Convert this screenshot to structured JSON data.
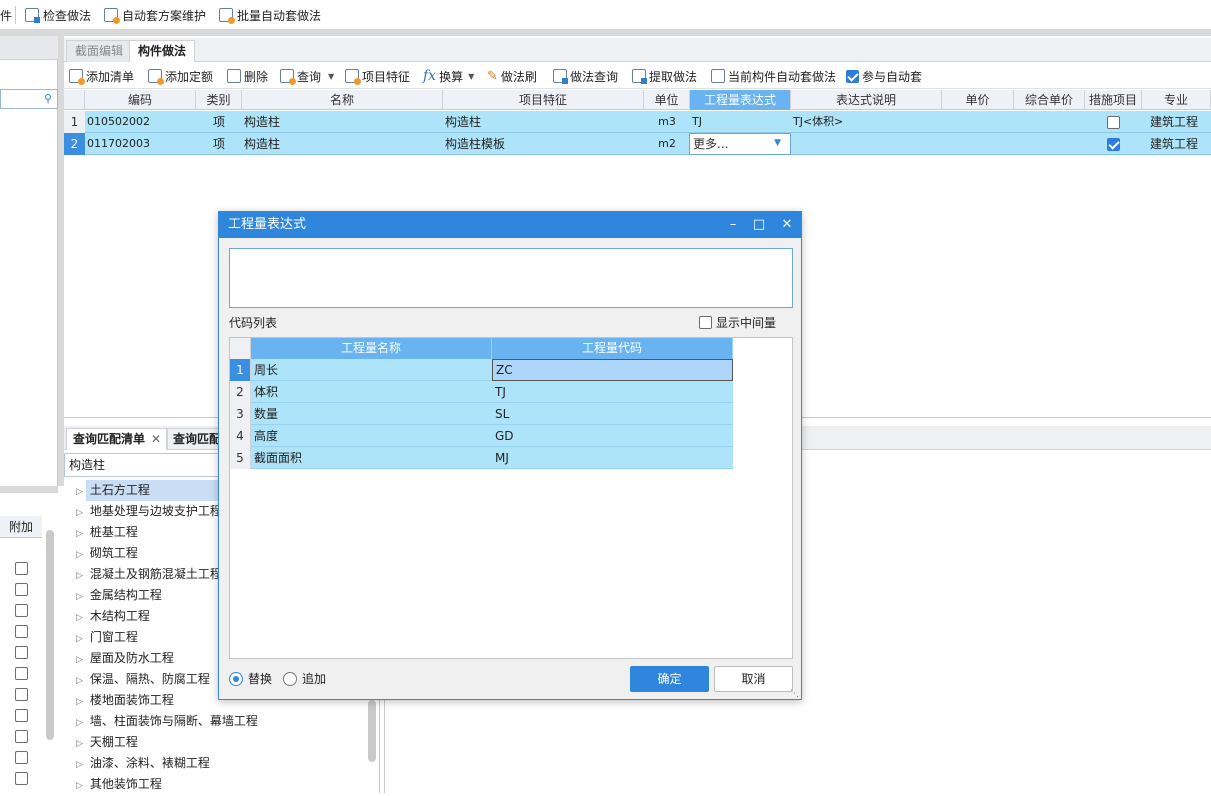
{
  "topbar": {
    "partial_label": "件",
    "items": [
      {
        "label": "检查做法",
        "icon": "check-doc-icon"
      },
      {
        "label": "自动套方案维护",
        "icon": "scheme-maintain-icon"
      },
      {
        "label": "批量自动套做法",
        "icon": "batch-apply-icon"
      }
    ]
  },
  "tabs": [
    "截面编辑",
    "构件做法"
  ],
  "toolbar": [
    {
      "label": "添加清单",
      "icon": "add-list-icon"
    },
    {
      "label": "添加定额",
      "icon": "add-quota-icon"
    },
    {
      "label": "删除",
      "icon": "delete-icon"
    },
    {
      "label": "查询",
      "icon": "query-icon",
      "dropdown": true
    },
    {
      "label": "项目特征",
      "icon": "feature-icon"
    },
    {
      "label": "换算",
      "icon": "fx-icon",
      "dropdown": true
    },
    {
      "label": "做法刷",
      "icon": "brush-icon"
    },
    {
      "label": "做法查询",
      "icon": "method-query-icon"
    },
    {
      "label": "提取做法",
      "icon": "extract-icon"
    },
    {
      "label": "当前构件自动套做法",
      "icon": "auto-apply-icon"
    },
    {
      "label": "参与自动套",
      "icon": "checkbox-icon",
      "checked": true
    }
  ],
  "grid": {
    "headers": [
      "编码",
      "类别",
      "名称",
      "项目特征",
      "单位",
      "工程量表达式",
      "表达式说明",
      "单价",
      "综合单价",
      "措施项目",
      "专业"
    ],
    "rows": [
      {
        "num": "1",
        "code": "010502002",
        "type": "项",
        "name": "构造柱",
        "feature": "构造柱",
        "unit": "m3",
        "expr": "TJ",
        "desc": "TJ<体积>",
        "measure": false,
        "major": "建筑工程"
      },
      {
        "num": "2",
        "code": "011702003",
        "type": "项",
        "name": "构造柱",
        "feature": "构造柱模板",
        "unit": "m2",
        "expr": "更多...",
        "desc": "",
        "measure": true,
        "major": "建筑工程"
      }
    ]
  },
  "bottom": {
    "tab1": "查询匹配清单",
    "tab2": "查询匹配",
    "search_value": "构造柱",
    "left_header": "附加",
    "tree": [
      "土石方工程",
      "地基处理与边坡支护工程",
      "桩基工程",
      "砌筑工程",
      "混凝土及钢筋混凝土工程",
      "金属结构工程",
      "木结构工程",
      "门窗工程",
      "屋面及防水工程",
      "保温、隔热、防腐工程",
      "楼地面装饰工程",
      "墙、柱面装饰与隔断、幕墙工程",
      "天棚工程",
      "油漆、涂料、裱糊工程",
      "其他装饰工程"
    ]
  },
  "dialog": {
    "title": "工程量表达式",
    "expr_value": "",
    "code_list_label": "代码列表",
    "show_intermediate": "显示中间量",
    "col_name": "工程量名称",
    "col_code": "工程量代码",
    "rows": [
      {
        "num": "1",
        "name": "周长",
        "code": "ZC"
      },
      {
        "num": "2",
        "name": "体积",
        "code": "TJ"
      },
      {
        "num": "3",
        "name": "数量",
        "code": "SL"
      },
      {
        "num": "4",
        "name": "高度",
        "code": "GD"
      },
      {
        "num": "5",
        "name": "截面面积",
        "code": "MJ"
      }
    ],
    "radio_replace": "替换",
    "radio_append": "追加",
    "ok": "确定",
    "cancel": "取消"
  }
}
